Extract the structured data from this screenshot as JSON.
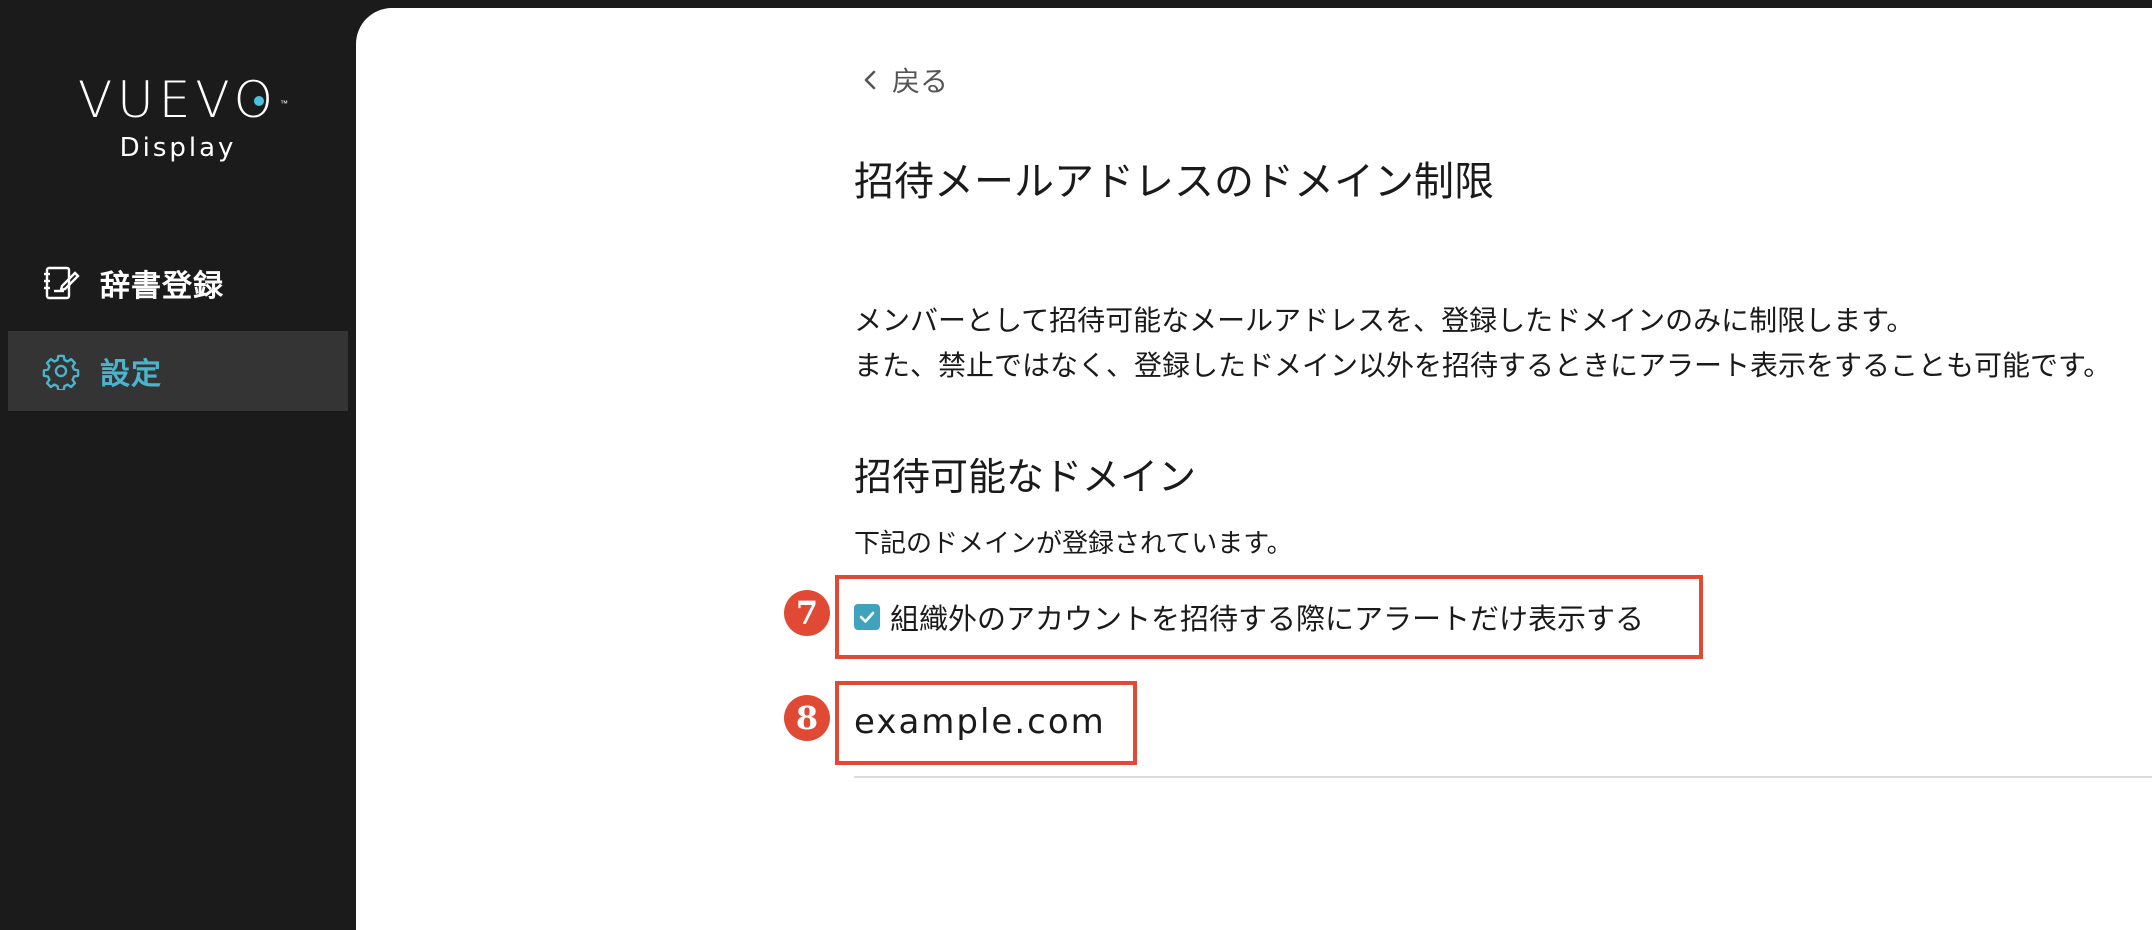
{
  "brand": {
    "logo_word": "VUEVO",
    "logo_tm": "™",
    "logo_sub": "Display",
    "accent_color": "#47c3e0"
  },
  "sidebar": {
    "items": [
      {
        "label": "辞書登録",
        "icon": "dictionary-edit-icon",
        "active": false
      },
      {
        "label": "設定",
        "icon": "gear-icon",
        "active": true
      }
    ]
  },
  "main": {
    "back_label": "戻る",
    "title": "招待メールアドレスのドメイン制限",
    "description_line1": "メンバーとして招待可能なメールアドレスを、登録したドメインのみに制限します。",
    "description_line2": "また、禁止ではなく、登録したドメイン以外を招待するときにアラート表示をすることも可能です。",
    "section_title": "招待可能なドメイン",
    "section_desc": "下記のドメインが登録されています。",
    "alert_only_checkbox": {
      "label": "組織外のアカウントを招待する際にアラートだけ表示する",
      "checked": true
    },
    "domains": [
      "example.com"
    ]
  },
  "annotations": {
    "badge_7": "7",
    "badge_8": "8",
    "color": "#e04a35"
  }
}
